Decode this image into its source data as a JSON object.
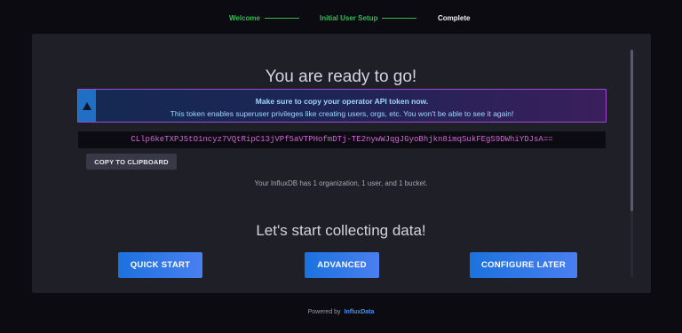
{
  "stepper": {
    "steps": [
      {
        "label": "Welcome",
        "state": "done"
      },
      {
        "label": "Initial User Setup",
        "state": "done"
      },
      {
        "label": "Complete",
        "state": "current"
      }
    ]
  },
  "main": {
    "title": "You are ready to go!",
    "alert": {
      "icon": "warning-icon",
      "title": "Make sure to copy your operator API token now.",
      "body": "This token enables superuser privileges like creating users, orgs, etc. You won't be able to see it again!"
    },
    "token": "CLlp6keTXPJ5tO1ncyz7VQtRipC13jVPf5aVTPHofmDTj-TE2nywWJqgJGyoBhjkn8imqSukFEgS9DWhiYDJsA==",
    "copy_button": "COPY TO CLIPBOARD",
    "summary": "Your InfluxDB has 1 organization, 1 user, and 1 bucket.",
    "subtitle": "Let's start collecting data!",
    "actions": {
      "quick_start": "QUICK START",
      "advanced": "ADVANCED",
      "configure_later": "CONFIGURE LATER"
    }
  },
  "footer": {
    "powered_by": "Powered by",
    "brand": "InfluxData"
  },
  "colors": {
    "done_step": "#34bb55",
    "token_text": "#d565d8",
    "button_gradient_start": "#1b72de",
    "button_gradient_end": "#4a7ff0",
    "alert_border": "#9b4ad1"
  }
}
